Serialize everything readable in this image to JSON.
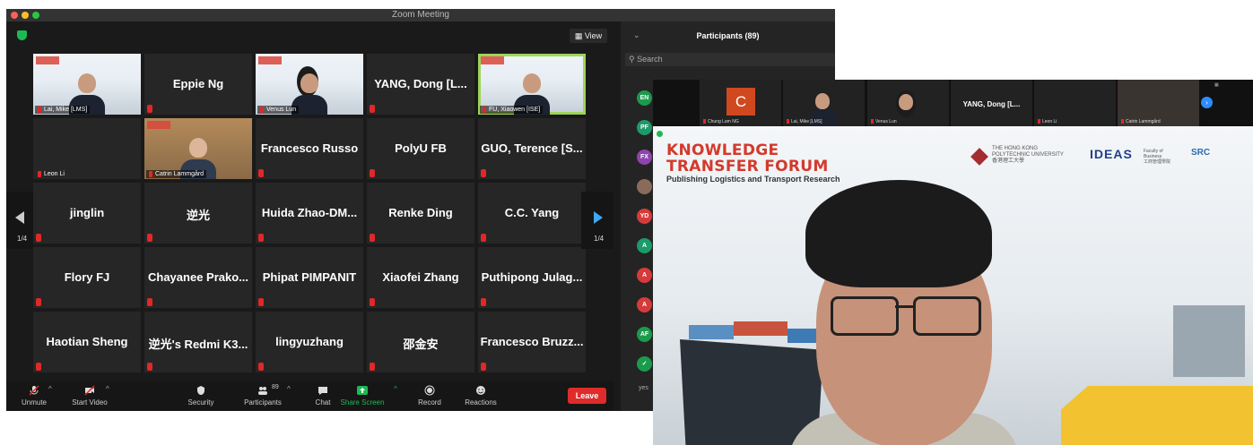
{
  "gallery_window": {
    "title": "Zoom Meeting",
    "view_label": "View",
    "page_indicator_left": "1/4",
    "page_indicator_right": "1/4",
    "tiles": [
      {
        "name": "Lai, Mike [LMS]",
        "kind": "video"
      },
      {
        "name": "Eppie Ng",
        "kind": "text"
      },
      {
        "name": "Venus Lun",
        "kind": "video"
      },
      {
        "name": "YANG, Dong [L...",
        "kind": "text"
      },
      {
        "name": "FU, Xiaowen [ISE]",
        "kind": "video"
      },
      {
        "name": "Leon Li",
        "kind": "label"
      },
      {
        "name": "Catrin Lammgård",
        "kind": "video"
      },
      {
        "name": "Francesco Russo",
        "kind": "text"
      },
      {
        "name": "PolyU FB",
        "kind": "text"
      },
      {
        "name": "GUO, Terence [S...",
        "kind": "text"
      },
      {
        "name": "jinglin",
        "kind": "text"
      },
      {
        "name": "逆光",
        "kind": "text"
      },
      {
        "name": "Huida Zhao-DM...",
        "kind": "text"
      },
      {
        "name": "Renke Ding",
        "kind": "text"
      },
      {
        "name": "C.C. Yang",
        "kind": "text"
      },
      {
        "name": "Flory FJ",
        "kind": "text"
      },
      {
        "name": "Chayanee Prako...",
        "kind": "text"
      },
      {
        "name": "Phipat PIMPANIT",
        "kind": "text"
      },
      {
        "name": "Xiaofei Zhang",
        "kind": "text"
      },
      {
        "name": "Puthipong Julag...",
        "kind": "text"
      },
      {
        "name": "Haotian Sheng",
        "kind": "text"
      },
      {
        "name": "逆光's Redmi K3...",
        "kind": "text"
      },
      {
        "name": "lingyuzhang",
        "kind": "text"
      },
      {
        "name": "邵金安",
        "kind": "text"
      },
      {
        "name": "Francesco Bruzz...",
        "kind": "text"
      }
    ],
    "toolbar": {
      "unmute": "Unmute",
      "start_video": "Start Video",
      "security": "Security",
      "participants": "Participants",
      "participants_count": "89",
      "chat": "Chat",
      "share_screen": "Share Screen",
      "record": "Record",
      "reactions": "Reactions",
      "leave": "Leave"
    },
    "sidebar": {
      "title": "Participants (89)",
      "search_placeholder": "Search",
      "avatars": [
        {
          "initials": "EN",
          "color": "#1c9a4c"
        },
        {
          "initials": "PF",
          "color": "#1c9a6a"
        },
        {
          "initials": "FX",
          "color": "#8e44ad"
        },
        {
          "initials": "",
          "color": "#8a6b5b"
        },
        {
          "initials": "YD",
          "color": "#d63b3b"
        },
        {
          "initials": "A",
          "color": "#1c9a6a"
        },
        {
          "initials": "A",
          "color": "#d63b3b"
        },
        {
          "initials": "A",
          "color": "#d63b3b"
        },
        {
          "initials": "AF",
          "color": "#1c9a4c"
        },
        {
          "initials": "",
          "color": "#1c9a4c"
        }
      ],
      "last_label": "yes"
    },
    "colors": {
      "accent_green": "#1db954",
      "leave_red": "#e02b2b",
      "selected_outline": "#9fd35a"
    }
  },
  "speaker_window": {
    "strip": {
      "tiles": [
        "Chung Lam NG",
        "Lai, Mike [LMS]",
        "Venus Lun",
        "YANG, Dong [L...",
        "Leon Li",
        "Catrin Lammgård"
      ],
      "avatar_letter": "C"
    },
    "slide": {
      "title_line1": "KNOWLEDGE",
      "title_line2": "TRANSFER FORUM",
      "subtitle": "Publishing Logistics and Transport Research",
      "polyu_line1": "THE HONG KONG",
      "polyu_line2": "POLYTECHNIC UNIVERSITY",
      "polyu_line3": "香港理工大學",
      "ideas": "IDEAS",
      "fob_line1": "Faculty of",
      "fob_line2": "Business",
      "fob_line3": "工商管理學院",
      "src": "SRC"
    }
  }
}
